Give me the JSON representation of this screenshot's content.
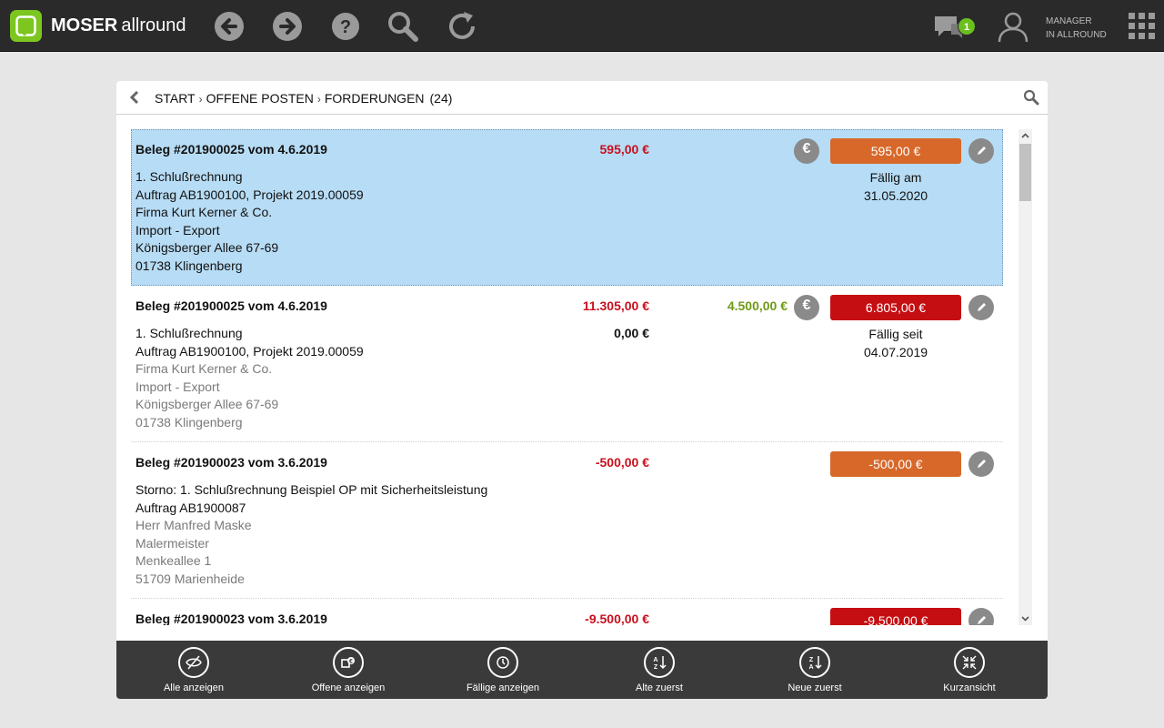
{
  "app": {
    "brand_bold": "MOSER",
    "brand_light": "allround",
    "chat_count": "1",
    "user_line1": "MANAGER",
    "user_line2": "IN ALLROUND"
  },
  "breadcrumb": {
    "start": "START",
    "sep": "›",
    "level1": "OFFENE POSTEN",
    "level2": "FORDERUNGEN",
    "count": "(24)"
  },
  "items": [
    {
      "title": "Beleg #201900025 vom 4.6.2019",
      "amount": "595,00 €",
      "status": "595,00 €",
      "status_color": "#d7682a",
      "due_label": "Fällig am",
      "due_date": "31.05.2020",
      "lines": [
        "1. Schlußrechnung",
        "Auftrag AB1900100, Projekt 2019.00059",
        "Firma Kurt Kerner & Co.",
        "Import - Export",
        "Königsberger Allee 67-69",
        "01738 Klingenberg"
      ],
      "euro_icon": "€"
    },
    {
      "title": "Beleg #201900025 vom 4.6.2019",
      "amount": "11.305,00 €",
      "amount2": "0,00 €",
      "paid": "4.500,00 €",
      "status": "6.805,00 €",
      "status_color": "#c50e12",
      "due_label": "Fällig seit",
      "due_date": "04.07.2019",
      "lines": [
        "1. Schlußrechnung",
        "Auftrag AB1900100, Projekt 2019.00059",
        "Firma Kurt Kerner & Co.",
        "Import - Export",
        "Königsberger Allee 67-69",
        "01738 Klingenberg"
      ],
      "euro_icon": "€"
    },
    {
      "title": "Beleg #201900023 vom 3.6.2019",
      "amount": "-500,00 €",
      "status": "-500,00 €",
      "status_color": "#d7682a",
      "lines": [
        "Storno: 1. Schlußrechnung Beispiel OP mit Sicherheitsleistung",
        "Auftrag AB1900087",
        "Herr Manfred Maske",
        "Malermeister",
        "Menkeallee 1",
        "51709 Marienheide"
      ]
    },
    {
      "title": "Beleg #201900023 vom 3.6.2019",
      "amount": "-9.500,00 €",
      "status": "-9.500,00 €",
      "status_color": "#c50e12"
    }
  ],
  "toolbar": {
    "show_all": "Alle anzeigen",
    "show_open": "Offene anzeigen",
    "show_due": "Fällige anzeigen",
    "oldest_first": "Alte zuerst",
    "newest_first": "Neue zuerst",
    "compact": "Kurzansicht"
  },
  "colors": {
    "accent": "#7cc61f",
    "topbar": "#2a2a2a",
    "selected": "#b7dcf5",
    "amount_red": "#c8101e",
    "paid_green": "#6f9a15"
  }
}
